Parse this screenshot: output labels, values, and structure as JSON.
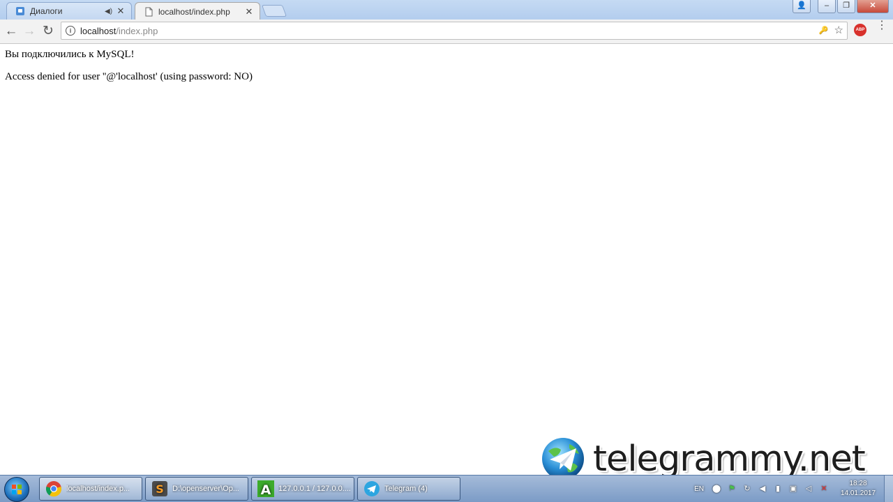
{
  "browser": {
    "tabs": [
      {
        "label": "Диалоги",
        "active": false,
        "has_sound": true
      },
      {
        "label": "localhost/index.php",
        "active": true,
        "has_sound": false
      }
    ],
    "close_glyph": "✕",
    "sound_glyph": "◀)",
    "window_buttons": {
      "user": "👤",
      "minimize": "–",
      "restore": "❐",
      "close": "✕"
    },
    "nav": {
      "back": "←",
      "forward": "→",
      "reload": "↻"
    },
    "address": {
      "host": "localhost",
      "path": "/index.php"
    },
    "omnibox_icons": {
      "key": "🔑",
      "star": "☆"
    },
    "extension_label": "ABP",
    "menu_glyph": "⋮"
  },
  "page": {
    "line1": "Вы подключились к MySQL!",
    "line2": "Access denied for user ''@'localhost' (using password: NO)"
  },
  "watermark": {
    "text": "telegrammy.net"
  },
  "taskbar": {
    "items": [
      {
        "label": "localhost/index.p...",
        "icon": "chrome-icon",
        "active": true
      },
      {
        "label": "D:\\openserver\\Op...",
        "icon": "sublime-icon",
        "active": false
      },
      {
        "label": "127.0.0.1 / 127.0.0....",
        "icon": "adminer-icon",
        "active": false
      },
      {
        "label": "Telegram (4)",
        "icon": "telegram-icon",
        "active": false
      }
    ],
    "tray": {
      "language": "EN",
      "time": "18:28",
      "date": "14.01.2017"
    }
  },
  "colors": {
    "accent_blue": "#2a8fd6",
    "abp_red": "#d8312c",
    "adminer_green": "#3cab2b"
  }
}
